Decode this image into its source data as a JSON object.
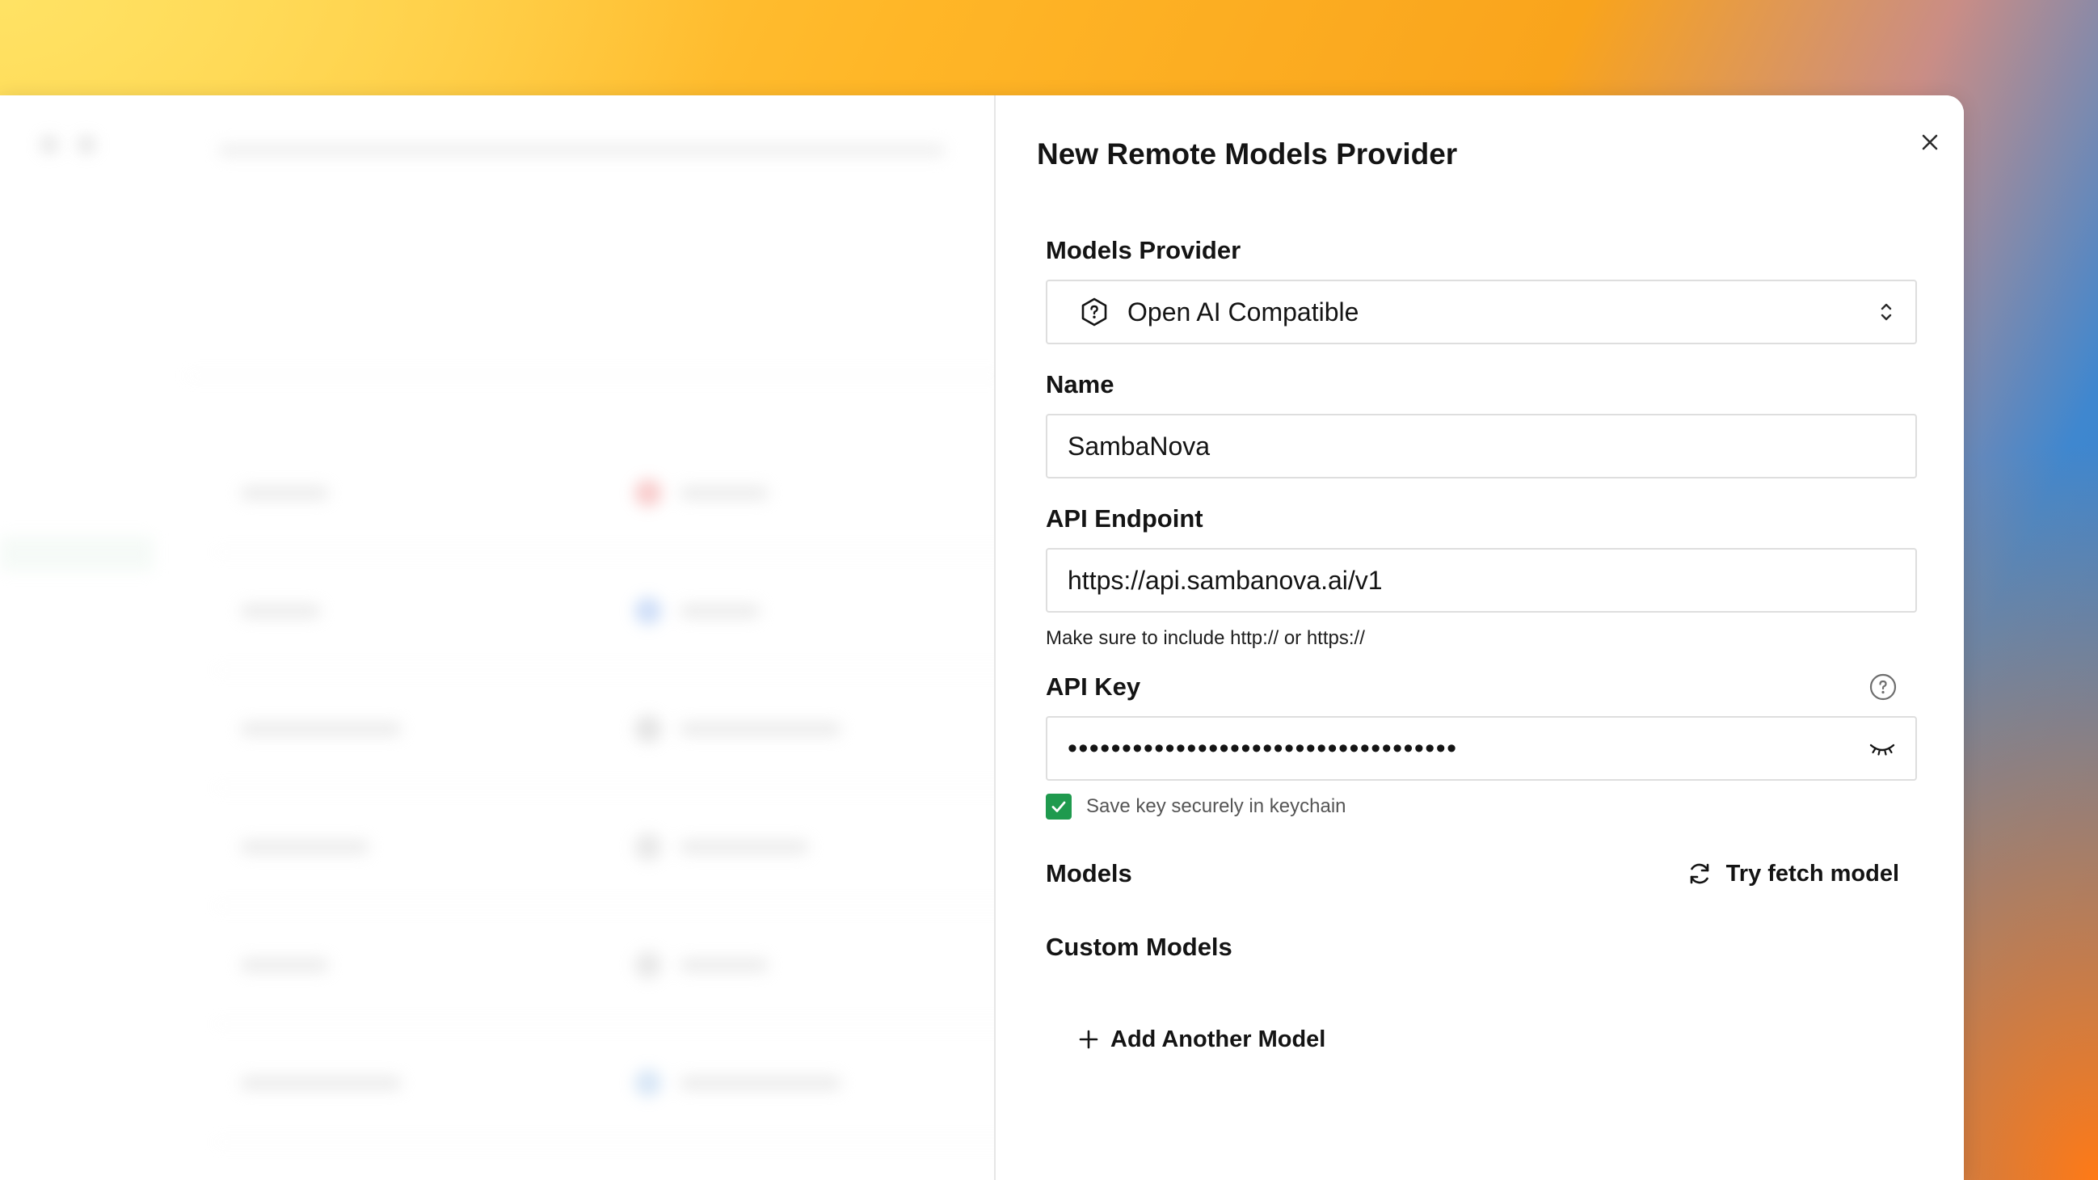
{
  "sheet": {
    "title": "New Remote Models Provider",
    "close_icon": "close-icon"
  },
  "form": {
    "provider": {
      "label": "Models Provider",
      "value": "Open AI Compatible",
      "icon": "hexagon-question-icon"
    },
    "name": {
      "label": "Name",
      "value": "SambaNova"
    },
    "endpoint": {
      "label": "API Endpoint",
      "value": "https://api.sambanova.ai/v1",
      "helper": "Make sure to include http:// or https://"
    },
    "api_key": {
      "label": "API Key",
      "masked_value": "••••••••••••••••••••••••••••••••••••",
      "save_label": "Save key securely in keychain",
      "save_checked": true
    },
    "models": {
      "label": "Models",
      "fetch_label": "Try fetch model"
    },
    "custom_models": {
      "label": "Custom Models",
      "add_label": "Add Another Model"
    }
  },
  "colors": {
    "checkbox": "#1f9a4e",
    "text": "#141414",
    "border": "#dedede"
  }
}
